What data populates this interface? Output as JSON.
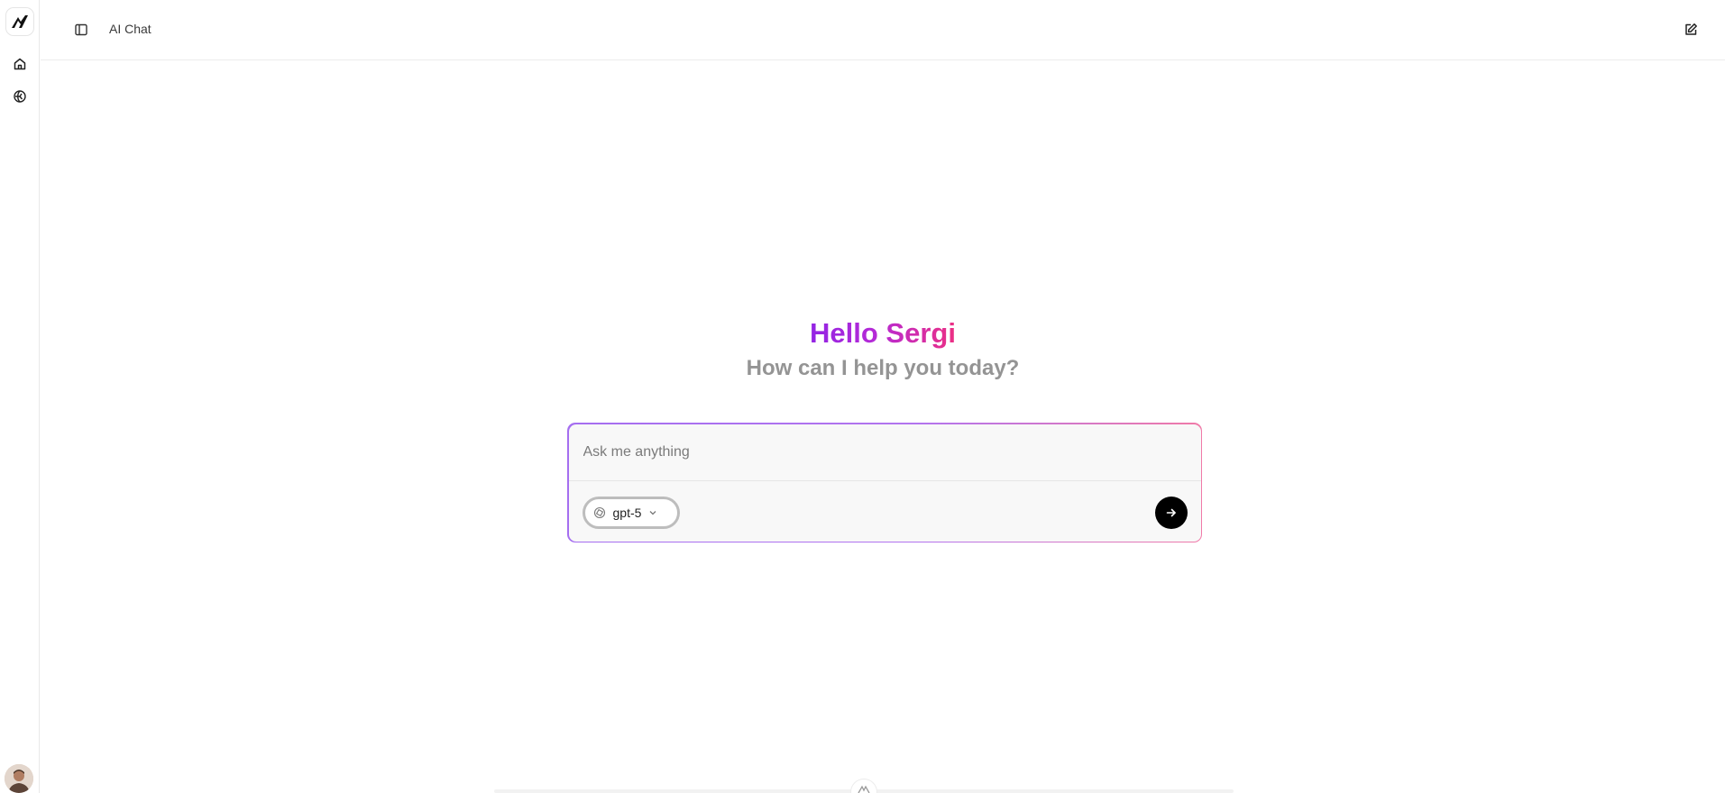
{
  "header": {
    "title": "AI Chat"
  },
  "main": {
    "greeting": "Hello Sergi",
    "subgreeting": "How can I help you today?"
  },
  "composer": {
    "placeholder": "Ask me anything",
    "model": "gpt-5"
  },
  "icons": {
    "logo": "brand-logo-icon",
    "home": "home-icon",
    "explore": "globe-icon",
    "sidebar_toggle": "sidebar-toggle-icon",
    "new_chat": "edit-icon",
    "model": "openai-icon",
    "chevron": "chevron-down-icon",
    "send": "arrow-right-icon"
  },
  "colors": {
    "greeting_start": "#9324e4",
    "greeting_end": "#ec2f83",
    "send_button": "#000000",
    "subgreeting": "#949494"
  }
}
